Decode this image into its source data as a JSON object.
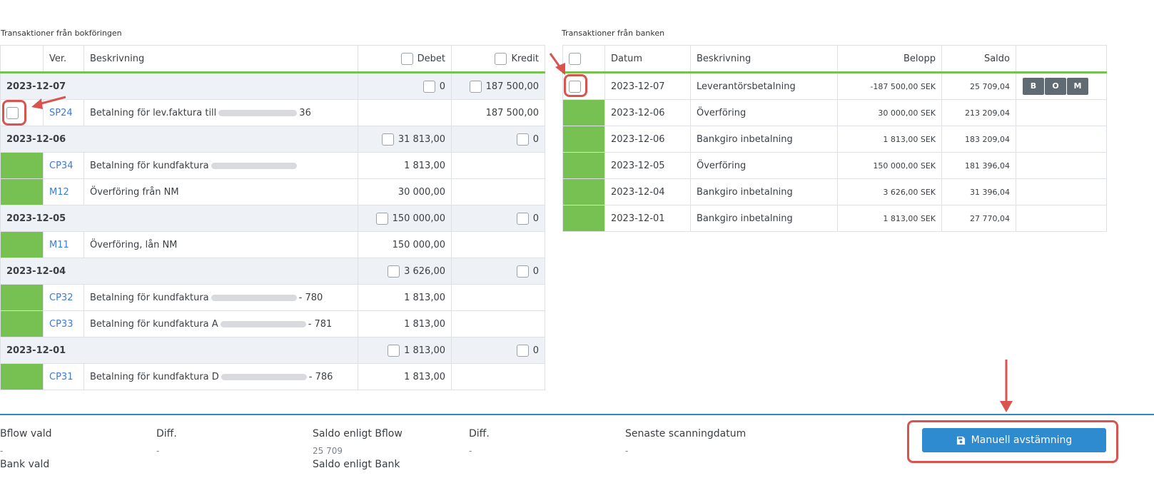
{
  "left": {
    "title": "Transaktioner från bokföringen",
    "headers": {
      "ver": "Ver.",
      "desc": "Beskrivning",
      "debet": "Debet",
      "kredit": "Kredit"
    },
    "groups": [
      {
        "date": "2023-12-07",
        "debet": "0",
        "kredit": "187 500,00",
        "rows": [
          {
            "ver": "SP24",
            "desc": "Betalning för lev.faktura till",
            "suffix": "36",
            "debet": "",
            "kredit": "187 500,00",
            "status": "checkbox"
          }
        ]
      },
      {
        "date": "2023-12-06",
        "debet": "31 813,00",
        "kredit": "0",
        "rows": [
          {
            "ver": "CP34",
            "desc": "Betalning för kundfaktura",
            "suffix": "",
            "debet": "1 813,00",
            "kredit": "",
            "status": "green"
          },
          {
            "ver": "M12",
            "desc": "Överföring från NM",
            "suffix": "",
            "debet": "30 000,00",
            "kredit": "",
            "status": "green"
          }
        ]
      },
      {
        "date": "2023-12-05",
        "debet": "150 000,00",
        "kredit": "0",
        "rows": [
          {
            "ver": "M11",
            "desc": "Överföring, lån NM",
            "suffix": "",
            "debet": "150 000,00",
            "kredit": "",
            "status": "green"
          }
        ]
      },
      {
        "date": "2023-12-04",
        "debet": "3 626,00",
        "kredit": "0",
        "rows": [
          {
            "ver": "CP32",
            "desc": "Betalning för kundfaktura",
            "suffix": "- 780",
            "debet": "1 813,00",
            "kredit": "",
            "status": "green"
          },
          {
            "ver": "CP33",
            "desc": "Betalning för kundfaktura A",
            "suffix": "- 781",
            "debet": "1 813,00",
            "kredit": "",
            "status": "green"
          }
        ]
      },
      {
        "date": "2023-12-01",
        "debet": "1 813,00",
        "kredit": "0",
        "rows": [
          {
            "ver": "CP31",
            "desc": "Betalning för kundfaktura D",
            "suffix": "- 786",
            "debet": "1 813,00",
            "kredit": "",
            "status": "green"
          }
        ]
      }
    ]
  },
  "right": {
    "title": "Transaktioner från banken",
    "headers": {
      "date": "Datum",
      "desc": "Beskrivning",
      "amount": "Belopp",
      "balance": "Saldo"
    },
    "rows": [
      {
        "date": "2023-12-07",
        "desc": "Leverantörsbetalning",
        "amount": "-187 500,00 SEK",
        "balance": "25 709,04",
        "status": "checkbox",
        "actions": [
          "B",
          "O",
          "M"
        ]
      },
      {
        "date": "2023-12-06",
        "desc": "Överföring",
        "amount": "30 000,00 SEK",
        "balance": "213 209,04",
        "status": "green"
      },
      {
        "date": "2023-12-06",
        "desc": "Bankgiro inbetalning",
        "amount": "1 813,00 SEK",
        "balance": "183 209,04",
        "status": "green"
      },
      {
        "date": "2023-12-05",
        "desc": "Överföring",
        "amount": "150 000,00 SEK",
        "balance": "181 396,04",
        "status": "green"
      },
      {
        "date": "2023-12-04",
        "desc": "Bankgiro inbetalning",
        "amount": "3 626,00 SEK",
        "balance": "31 396,04",
        "status": "green"
      },
      {
        "date": "2023-12-01",
        "desc": "Bankgiro inbetalning",
        "amount": "1 813,00 SEK",
        "balance": "27 770,04",
        "status": "green"
      }
    ]
  },
  "footer": {
    "bflow_vald": "Bflow vald",
    "bflow_vald_val": "-",
    "diff1": "Diff.",
    "diff1_val": "-",
    "saldo_bflow": "Saldo enligt Bflow",
    "saldo_bflow_val": "25 709",
    "diff2": "Diff.",
    "diff2_val": "-",
    "senaste": "Senaste scanningdatum",
    "senaste_val": "-",
    "bank_vald": "Bank vald",
    "saldo_bank": "Saldo enligt Bank",
    "manual_button": "Manuell avstämning"
  },
  "colors": {
    "green": "#77c152",
    "accent": "#2e8bd0",
    "highlight": "#d9534f"
  },
  "icons": {
    "manual_button": "save-icon",
    "annotation": "arrow-icon"
  }
}
